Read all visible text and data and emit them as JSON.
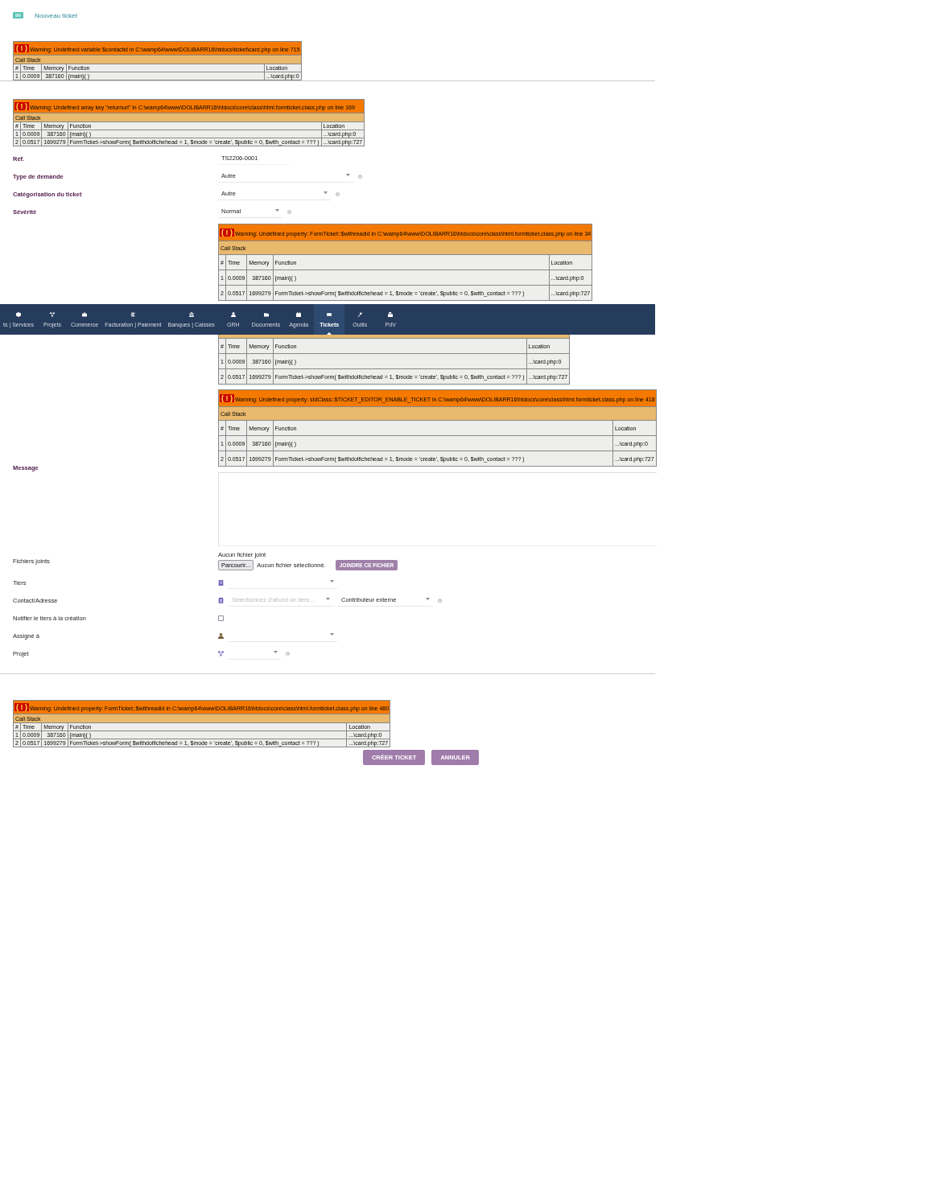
{
  "header": {
    "title": "Nouveau ticket"
  },
  "top_warnings": [
    {
      "badge": "( ! )",
      "message": "Warning: Undefined variable $contactid in C:\\wamp64\\www\\DOLIBARR16\\htdocs\\ticket\\card.php on line 715",
      "call_stack": "Call Stack",
      "columns": [
        "#",
        "Time",
        "Memory",
        "Function",
        "Location"
      ],
      "rows": [
        [
          "1",
          "0.0009",
          "387160",
          "{main}( )",
          "...\\card.php:0"
        ]
      ]
    },
    {
      "badge": "( ! )",
      "message": "Warning: Undefined array key \"returnurl\" in C:\\wamp64\\www\\DOLIBARR16\\htdocs\\core\\class\\html.formticket.class.php on line 169",
      "call_stack": "Call Stack",
      "columns": [
        "#",
        "Time",
        "Memory",
        "Function",
        "Location"
      ],
      "rows": [
        [
          "1",
          "0.0009",
          "387160",
          "{main}( )",
          "...\\card.php:0"
        ],
        [
          "2",
          "0.0517",
          "1699279",
          "FormTicket->showForm( $withdolfichehead = 1, $mode = 'create', $public = 0, $with_contact = ??? )",
          "...\\card.php:727"
        ]
      ]
    }
  ],
  "form": {
    "fields": [
      {
        "kind": "text",
        "label": "Réf.",
        "required": true,
        "value": "TS2206-0001"
      },
      {
        "kind": "select",
        "label": "Type de demande",
        "required": true,
        "value": "Autre",
        "info": true
      },
      {
        "kind": "select",
        "label": "Catégorisation du ticket",
        "required": true,
        "value": "Autre",
        "info": true
      },
      {
        "kind": "select",
        "label": "Sévérité",
        "required": true,
        "value": "Normal",
        "info": true
      },
      {
        "kind": "warning",
        "warning": {
          "badge": "( ! )",
          "message": "Warning: Undefined property: FormTicket::$withreadid in C:\\wamp64\\www\\DOLIBARR16\\htdocs\\core\\class\\html.formticket.class.php on line 34",
          "call_stack": "Call Stack",
          "columns": [
            "#",
            "Time",
            "Memory",
            "Function",
            "Location"
          ],
          "rows": [
            [
              "1",
              "0.0009",
              "387160",
              "{main}( )",
              "...\\card.php:0"
            ],
            [
              "2",
              "0.0517",
              "1699279",
              "FormTicket->showForm( $withdolfichehead = 1, $mode = 'create', $public = 0, $with_contact = ??? )",
              "...\\card.php:727"
            ]
          ]
        }
      },
      {
        "kind": "covered_warning",
        "warning": {
          "columns": [
            "#",
            "Time",
            "Memory",
            "Function",
            "Location"
          ],
          "rows": [
            [
              "1",
              "0.0009",
              "387160",
              "{main}( )",
              "...\\card.php:0"
            ],
            [
              "2",
              "0.0517",
              "1699279",
              "FormTicket->showForm( $withdolfichehead = 1, $mode = 'create', $public = 0, $with_contact = ??? )",
              "...\\card.php:727"
            ]
          ]
        }
      },
      {
        "kind": "message",
        "label": "Message",
        "required": true,
        "warning": {
          "badge": "( ! )",
          "message": "Warning: Undefined property: stdClass::$TICKET_EDITOR_ENABLE_TICKET in C:\\wamp64\\www\\DOLIBARR16\\htdocs\\core\\class\\html.formticket.class.php on line 418",
          "call_stack": "Call Stack",
          "columns": [
            "#",
            "Time",
            "Memory",
            "Function",
            "Location"
          ],
          "rows": [
            [
              "1",
              "0.0009",
              "387160",
              "{main}( )",
              "...\\card.php:0"
            ],
            [
              "2",
              "0.0517",
              "1699279",
              "FormTicket->showForm( $withdolfichehead = 1, $mode = 'create', $public = 0, $with_contact = ??? )",
              "...\\card.php:727"
            ]
          ]
        }
      },
      {
        "kind": "files",
        "label": "Fichiers joints",
        "required": false,
        "status": "Aucun fichier joint",
        "browse": "Parcourir...",
        "chosen": "Aucun fichier sélectionné.",
        "attach": "JOINDRE CE FICHIER"
      },
      {
        "kind": "select",
        "label": "Tiers",
        "required": false,
        "info": false
      },
      {
        "kind": "contact",
        "label": "Contact/Adresse",
        "required": false,
        "placeholder": "Sélectionnez d'abord un tiers...",
        "role": "Contributeur externe",
        "info": true
      },
      {
        "kind": "checkbox",
        "label": "Notifier le tiers à la création",
        "required": false,
        "checked": false
      },
      {
        "kind": "select",
        "label": "Assigné à",
        "required": false,
        "info": false
      },
      {
        "kind": "select",
        "label": "Projet",
        "required": false,
        "info": true
      }
    ]
  },
  "navbar": {
    "items": [
      {
        "label": "ts | Services",
        "selected": false
      },
      {
        "label": "Projets",
        "selected": false
      },
      {
        "label": "Commerce",
        "selected": false
      },
      {
        "label": "Facturation | Paiement",
        "selected": false
      },
      {
        "label": "Banques | Caisses",
        "selected": false
      },
      {
        "label": "GRH",
        "selected": false
      },
      {
        "label": "Documents",
        "selected": false
      },
      {
        "label": "Agenda",
        "selected": false
      },
      {
        "label": "Tickets",
        "selected": true
      },
      {
        "label": "Outils",
        "selected": false
      },
      {
        "label": "PdV",
        "selected": false
      }
    ]
  },
  "bottom_warning": {
    "badge": "( ! )",
    "message": "Warning: Undefined property: FormTicket::$withreadid in C:\\wamp64\\www\\DOLIBARR16\\htdocs\\core\\class\\html.formticket.class.php on line 480",
    "call_stack": "Call Stack",
    "columns": [
      "#",
      "Time",
      "Memory",
      "Function",
      "Location"
    ],
    "rows": [
      [
        "1",
        "0.0009",
        "387160",
        "{main}( )",
        "...\\card.php:0"
      ],
      [
        "2",
        "0.0517",
        "1699279",
        "FormTicket->showForm( $withdolfichehead = 1, $mode = 'create', $public = 0, $with_contact = ??? )",
        "...\\card.php:727"
      ]
    ]
  },
  "buttons": [
    {
      "label": "CRÉER TICKET"
    },
    {
      "label": "ANNULER"
    }
  ]
}
